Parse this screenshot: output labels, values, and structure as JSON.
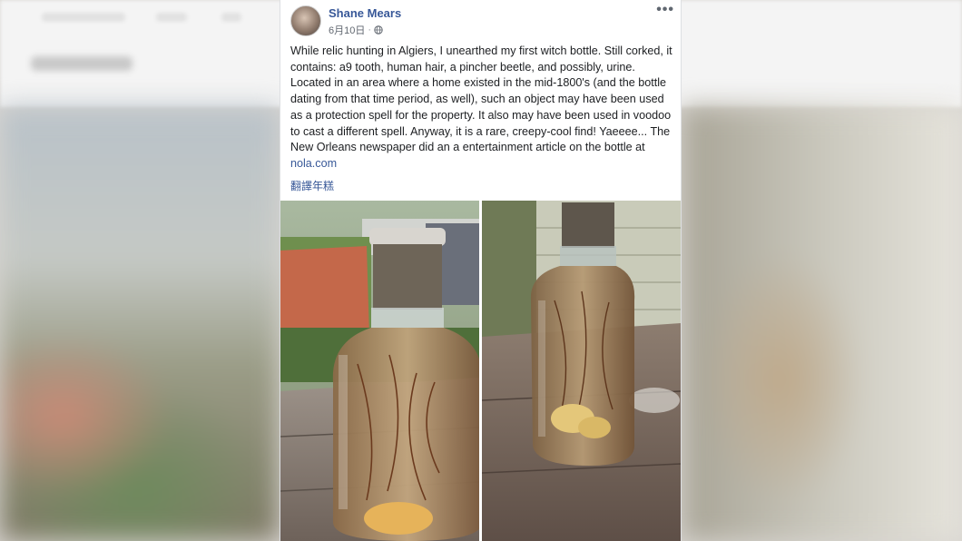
{
  "post": {
    "author": "Shane Mears",
    "date": "6月10日",
    "separator": "·",
    "privacy_icon": "globe-icon",
    "more_icon": "more-options-icon",
    "text": "While relic hunting in Algiers, I unearthed my first witch bottle. Still corked, it contains: a9 tooth, human hair, a pincher beetle, and possibly, urine. Located in an area where a home existed in the mid-1800's (and the bottle dating from that time period, as well), such an object may have been used as a protection spell for the property. It also may have been used in voodoo to cast a different spell. Anyway, it is a rare, creepy-cool find! Yaeeee... The New Orleans newspaper did an a entertainment article on the bottle at ",
    "link_text": "nola.com",
    "translate_label": "翻譯年糕"
  },
  "colors": {
    "author_link": "#385898",
    "text": "#1c1e21",
    "meta": "#616770"
  },
  "photos": [
    {
      "subject": "witch bottle with hair and beetle, street background"
    },
    {
      "subject": "witch bottle on wooden table, house siding background"
    }
  ]
}
